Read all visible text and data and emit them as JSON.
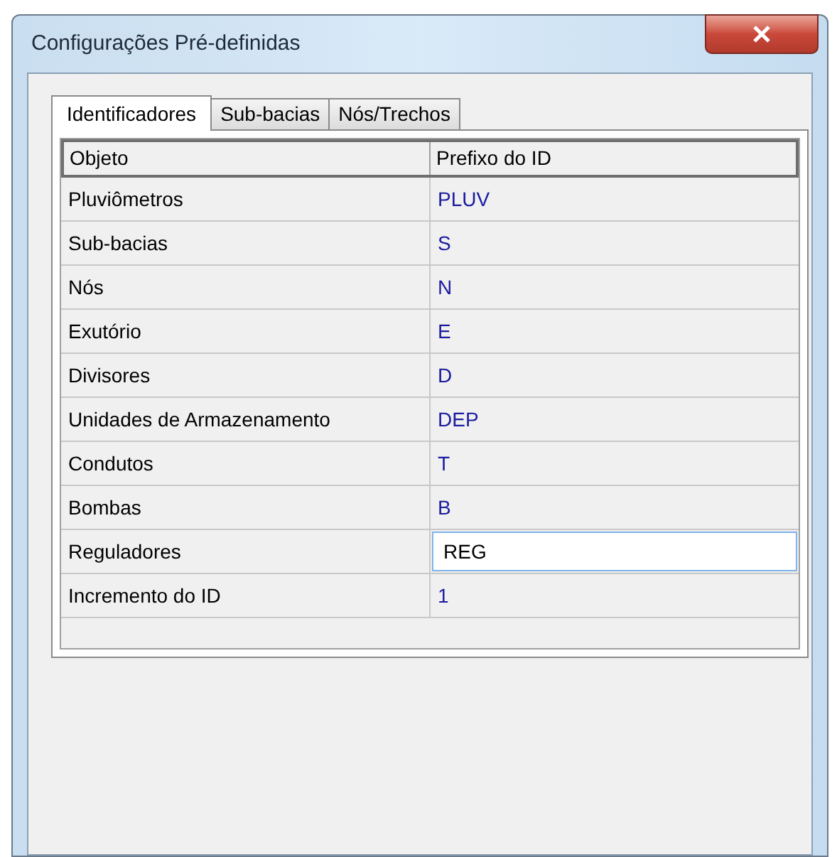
{
  "window": {
    "title": "Configurações Pré-definidas"
  },
  "tabs": [
    {
      "label": "Identificadores",
      "selected": true
    },
    {
      "label": "Sub-bacias",
      "selected": false
    },
    {
      "label": "Nós/Trechos",
      "selected": false
    }
  ],
  "table": {
    "columns": [
      "Objeto",
      "Prefixo do ID"
    ],
    "rows": [
      {
        "name": "Pluviômetros",
        "value": "PLUV",
        "kind": "text"
      },
      {
        "name": "Sub-bacias",
        "value": "S",
        "kind": "text"
      },
      {
        "name": "Nós",
        "value": "N",
        "kind": "text"
      },
      {
        "name": "Exutório",
        "value": "E",
        "kind": "text"
      },
      {
        "name": "Divisores",
        "value": "D",
        "kind": "text"
      },
      {
        "name": "Unidades de Armazenamento",
        "value": "DEP",
        "kind": "text"
      },
      {
        "name": "Condutos",
        "value": "T",
        "kind": "text"
      },
      {
        "name": "Bombas",
        "value": "B",
        "kind": "text"
      },
      {
        "name": "Reguladores",
        "value": "REG",
        "kind": "edit"
      },
      {
        "name": "Incremento do ID",
        "value": "1",
        "kind": "text"
      }
    ]
  }
}
